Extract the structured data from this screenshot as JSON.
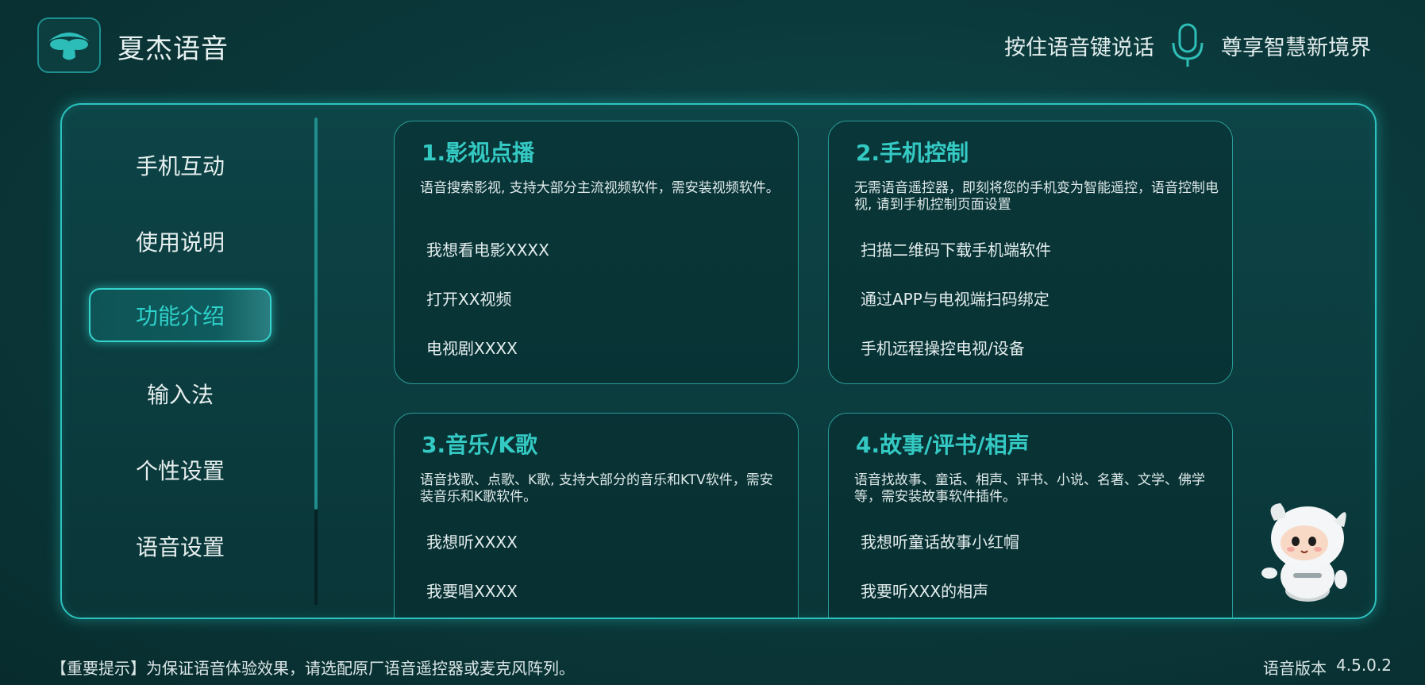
{
  "app": {
    "title": "夏杰语音"
  },
  "header": {
    "hint_left": "按住语音键说话",
    "hint_right": "尊享智慧新境界",
    "mic_icon": "microphone-icon"
  },
  "sidebar": {
    "items": [
      {
        "label": "手机互动"
      },
      {
        "label": "使用说明"
      },
      {
        "label": "功能介绍",
        "active": true
      },
      {
        "label": "输入法"
      },
      {
        "label": "个性设置"
      },
      {
        "label": "语音设置"
      }
    ]
  },
  "cards": [
    {
      "title": "1.影视点播",
      "desc": "语音搜索影视, 支持大部分主流视频软件，需安装视频软件。",
      "examples": [
        "我想看电影XXXX",
        "打开XX视频",
        "电视剧XXXX"
      ]
    },
    {
      "title": "2.手机控制",
      "desc": "无需语音遥控器，即刻将您的手机变为智能遥控，语音控制电视, 请到手机控制页面设置",
      "examples": [
        "扫描二维码下载手机端软件",
        "通过APP与电视端扫码绑定",
        "手机远程操控电视/设备"
      ]
    },
    {
      "title": "3.音乐/K歌",
      "desc": "语音找歌、点歌、K歌, 支持大部分的音乐和KTV软件，需安装音乐和K歌软件。",
      "examples": [
        "我想听XXXX",
        "我要唱XXXX"
      ]
    },
    {
      "title": "4.故事/评书/相声",
      "desc": "语音找故事、童话、相声、评书、小说、名著、文学、佛学等，需安装故事软件插件。",
      "examples": [
        "我想听童话故事小红帽",
        "我要听XXX的相声"
      ]
    }
  ],
  "footer": {
    "tip": "【重要提示】为保证语音体验效果，请选配原厂语音遥控器或麦克风阵列。",
    "version_label": "语音版本",
    "version": "4.5.0.2"
  },
  "colors": {
    "accent": "#34c9c3",
    "background": "#0b3a3c",
    "border": "#2bc3bf"
  }
}
